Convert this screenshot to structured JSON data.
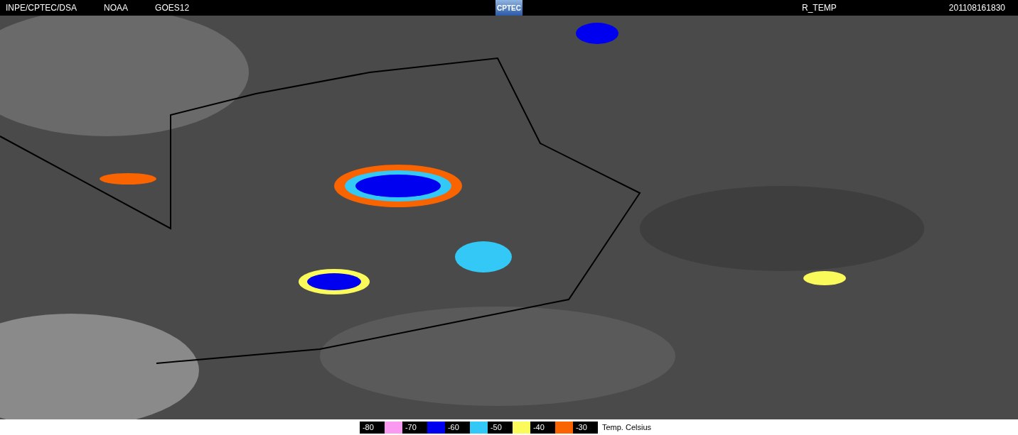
{
  "header": {
    "left": [
      "INPE/CPTEC/DSA",
      "NOAA",
      "GOES12"
    ],
    "logo": "CPTEC",
    "product": "R_TEMP",
    "timestamp": "201108161830"
  },
  "legend": {
    "items": [
      {
        "kind": "label",
        "text": "-80"
      },
      {
        "kind": "swatch",
        "color": "#f99af0"
      },
      {
        "kind": "label",
        "text": "-70"
      },
      {
        "kind": "swatch",
        "color": "#0000f0"
      },
      {
        "kind": "label",
        "text": "-60"
      },
      {
        "kind": "swatch",
        "color": "#33c8f5"
      },
      {
        "kind": "label",
        "text": "-50"
      },
      {
        "kind": "swatch",
        "color": "#fafa5a"
      },
      {
        "kind": "label",
        "text": "-40"
      },
      {
        "kind": "swatch",
        "color": "#fa6400"
      },
      {
        "kind": "label",
        "text": "-30"
      }
    ],
    "unit": "Temp. Celsius"
  }
}
